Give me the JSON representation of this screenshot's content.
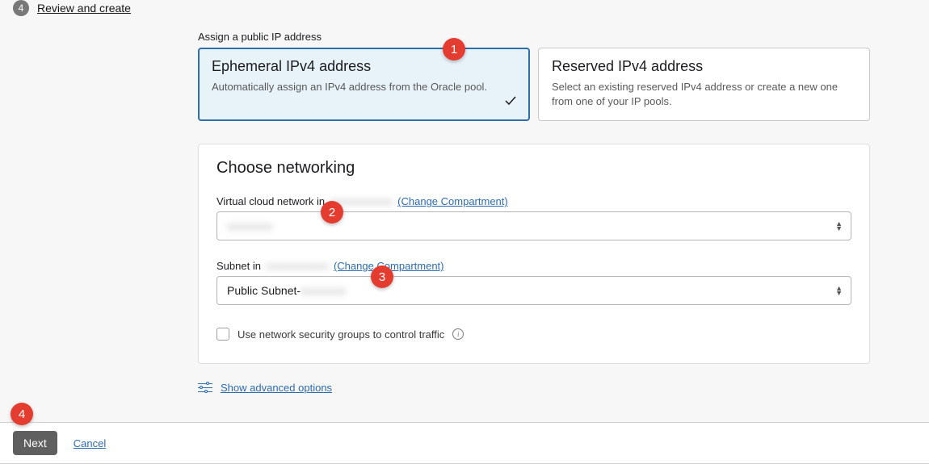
{
  "step": {
    "number": "4",
    "label": "Review and create"
  },
  "ip": {
    "section_label": "Assign a public IP address",
    "ephemeral": {
      "title": "Ephemeral IPv4 address",
      "desc": "Automatically assign an IPv4 address from the Oracle pool."
    },
    "reserved": {
      "title": "Reserved IPv4 address",
      "desc": "Select an existing reserved IPv4 address or create a new one from one of your IP pools."
    }
  },
  "networking": {
    "heading": "Choose networking",
    "vcn_label_prefix": "Virtual cloud network in ",
    "vcn_compartment_masked": "xxxxxxxxxxxx",
    "vcn_change": "(Change Compartment)",
    "vcn_value_masked": "xxxxxxxx",
    "subnet_label_prefix": "Subnet in ",
    "subnet_compartment_masked": "xxxxxxxxxxxx",
    "subnet_change": "(Change Compartment)",
    "subnet_value_prefix": "Public Subnet-",
    "subnet_value_masked": "xxxxxxxx",
    "nsg_label": "Use network security groups to control traffic"
  },
  "advanced": {
    "label": "Show advanced options"
  },
  "footer": {
    "next": "Next",
    "cancel": "Cancel"
  },
  "callouts": {
    "c1": "1",
    "c2": "2",
    "c3": "3",
    "c4": "4"
  }
}
